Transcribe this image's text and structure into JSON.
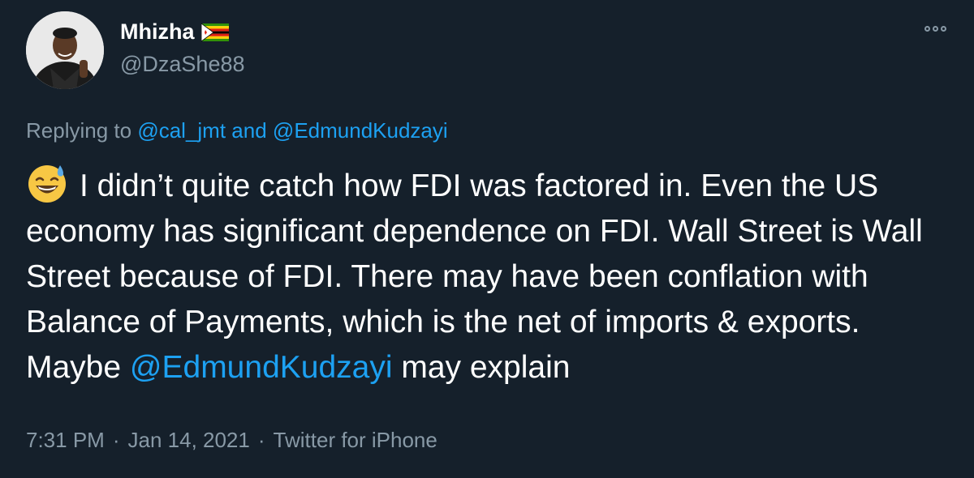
{
  "author": {
    "display_name": "Mhizha",
    "handle": "@DzaShe88",
    "flag_icon": "zimbabwe-flag-icon"
  },
  "reply": {
    "prefix": "Replying to",
    "mention_1": "@cal_jmt",
    "joiner": "and",
    "mention_2": "@EdmundKudzayi"
  },
  "tweet": {
    "emoji_icon": "sweat-smile-emoji-icon",
    "text_before_mention": "I didn’t quite catch how FDI was factored in. Even the US economy has significant dependence on FDI. Wall Street is Wall Street because of FDI. There may have been conflation with Balance of Payments, which is the net of imports & exports. Maybe",
    "mention": "@EdmundKudzayi",
    "text_after_mention": "may explain"
  },
  "meta": {
    "time": "7:31 PM",
    "separator": "·",
    "date": "Jan 14, 2021",
    "source": "Twitter for iPhone"
  },
  "colors": {
    "background": "#15202b",
    "secondary_text": "#8899a6",
    "link": "#1da1f2",
    "primary_text": "#ffffff"
  }
}
